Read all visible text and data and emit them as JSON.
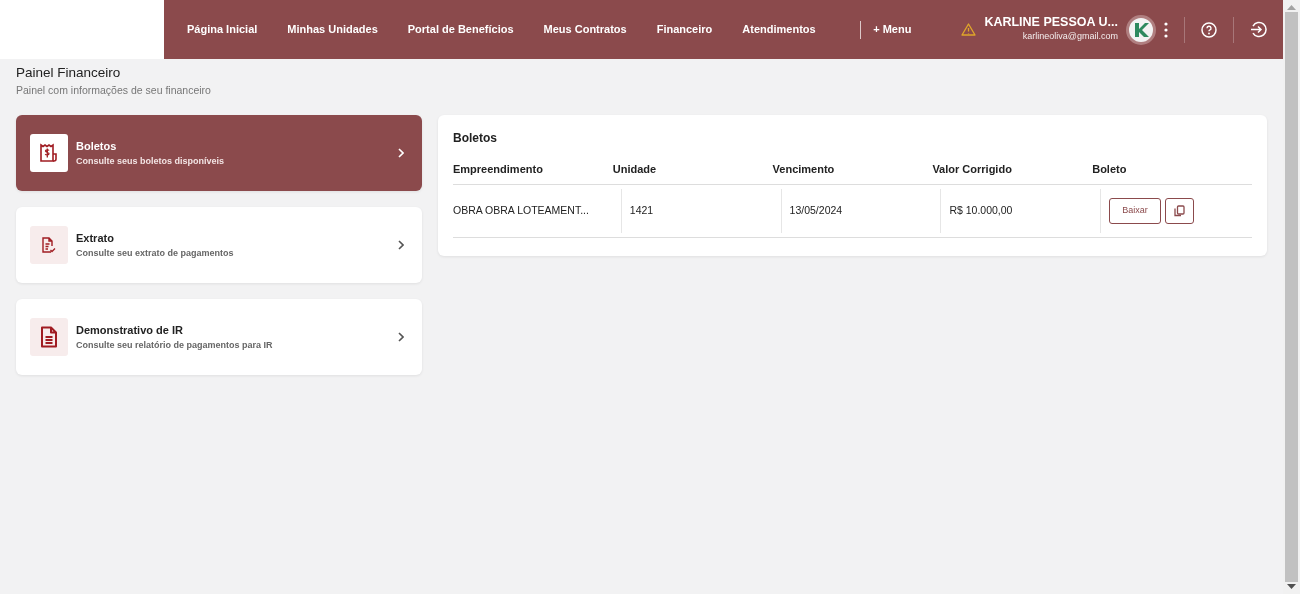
{
  "nav": {
    "links": [
      "Página Inicial",
      "Minhas Unidades",
      "Portal de Benefícios",
      "Meus Contratos",
      "Financeiro",
      "Atendimentos"
    ],
    "more_menu": "+ Menu",
    "user": {
      "name": "KARLINE PESSOA U...",
      "email": "karlineoliva@gmail.com",
      "warning": true
    }
  },
  "page": {
    "title": "Painel Financeiro",
    "subtitle": "Painel com informações de seu financeiro"
  },
  "options": [
    {
      "kind": "boleto",
      "title": "Boletos",
      "description": "Consulte seus boletos disponíveis",
      "selected": true
    },
    {
      "kind": "extrato",
      "title": "Extrato",
      "description": "Consulte seu extrato de pagamentos",
      "selected": false
    },
    {
      "kind": "ir",
      "title": "Demonstrativo de IR",
      "description": "Consulte seu relatório de pagamentos para IR",
      "selected": false
    }
  ],
  "boletos": {
    "title": "Boletos",
    "columns": [
      "Empreendimento",
      "Unidade",
      "Vencimento",
      "Valor Corrigido",
      "Boleto"
    ],
    "rows": [
      {
        "empreendimento": "OBRA OBRA LOTEAMENT...",
        "unidade": "1421",
        "vencimento": "13/05/2024",
        "valor": "R$ 10.000,00",
        "download_label": "Baixar"
      }
    ]
  }
}
